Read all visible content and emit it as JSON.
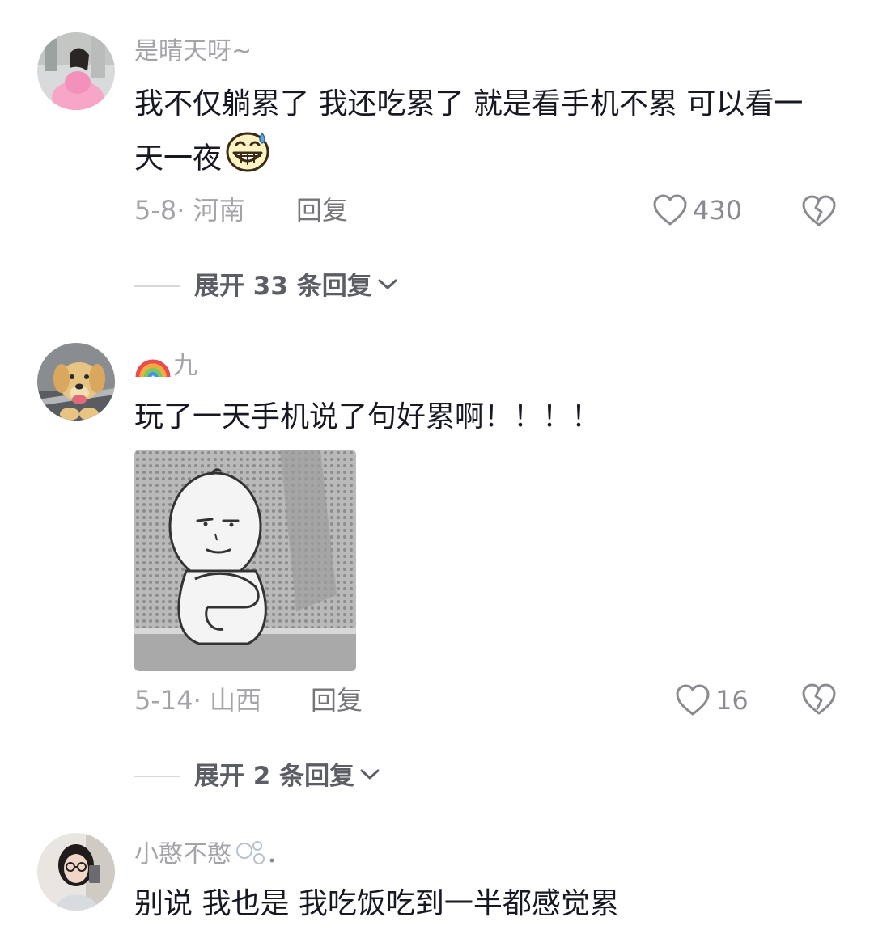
{
  "comments": [
    {
      "username": "是晴天呀~",
      "text": "我不仅躺累了 我还吃累了 就是看手机不累 可以看一天一夜",
      "date": "5-8",
      "location": "河南",
      "reply_label": "回复",
      "likes": "430",
      "expand_label": "展开 33 条回复"
    },
    {
      "username": "九",
      "text": "玩了一天手机说了句好累啊！！！！",
      "date": "5-14",
      "location": "山西",
      "reply_label": "回复",
      "likes": "16",
      "expand_label": "展开 2 条回复"
    },
    {
      "username": "小憨不憨",
      "text": "别说 我也是 我吃饭吃到一半都感觉累"
    }
  ],
  "icons": {
    "emoji": "grinning-sweat-emoji",
    "rainbow": "rainbow-emoji",
    "like": "heart-outline-icon",
    "dislike": "broken-heart-icon",
    "expand": "chevron-down-icon",
    "bubbles": "bubbles-emoji"
  },
  "colors": {
    "text": "#161823",
    "muted": "#a3a3a8",
    "background": "#ffffff"
  }
}
